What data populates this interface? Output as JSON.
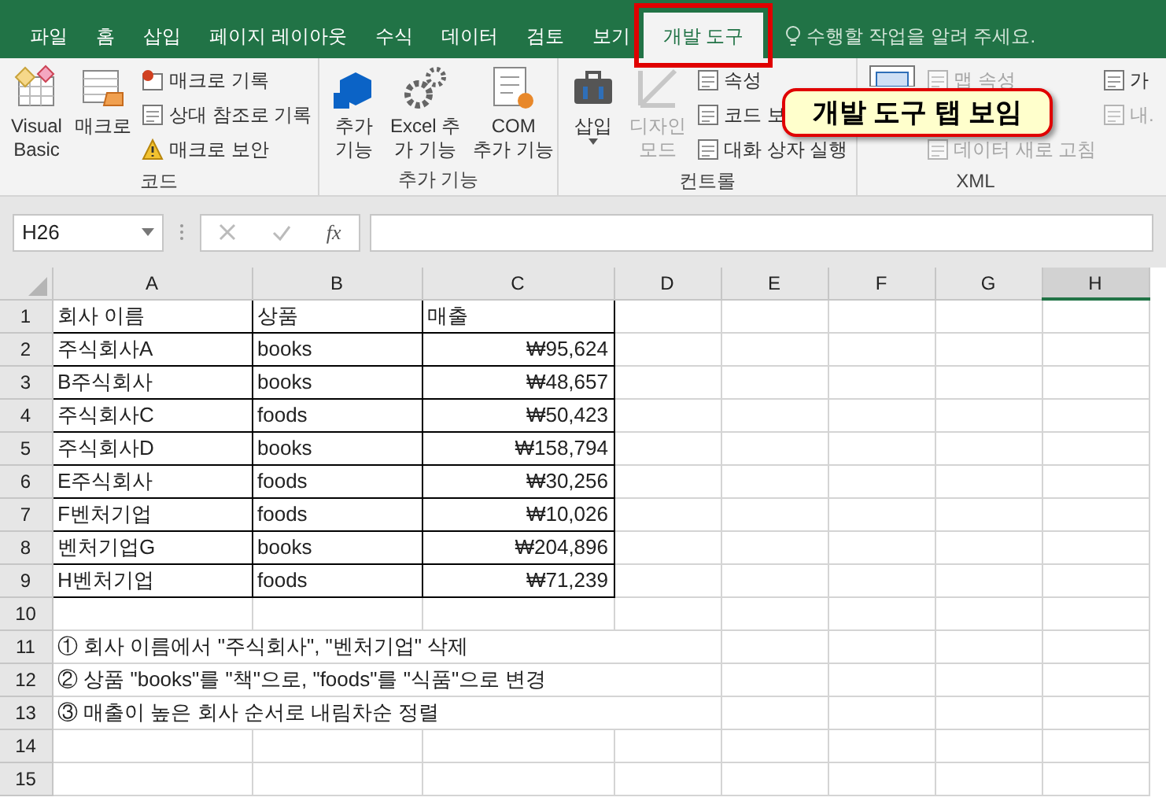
{
  "tabs": [
    {
      "label": "파일",
      "selected": false
    },
    {
      "label": "홈",
      "selected": false
    },
    {
      "label": "삽입",
      "selected": false
    },
    {
      "label": "페이지 레이아웃",
      "selected": false
    },
    {
      "label": "수식",
      "selected": false
    },
    {
      "label": "데이터",
      "selected": false
    },
    {
      "label": "검토",
      "selected": false
    },
    {
      "label": "보기",
      "selected": false
    },
    {
      "label": "개발 도구",
      "selected": true,
      "highlighted": true
    }
  ],
  "tell_me": {
    "placeholder": "수행할 작업을 알려 주세요."
  },
  "ribbon": {
    "groups": [
      {
        "label": "코드",
        "items": [
          {
            "kind": "large",
            "label": "Visual\nBasic",
            "disabled": false
          },
          {
            "kind": "large",
            "label": "매크로",
            "disabled": false
          },
          {
            "kind": "small",
            "label": "매크로 기록",
            "disabled": false
          },
          {
            "kind": "small",
            "label": "상대 참조로 기록",
            "disabled": false
          },
          {
            "kind": "small",
            "label": "매크로 보안",
            "disabled": false
          }
        ]
      },
      {
        "label": "추가 기능",
        "items": [
          {
            "kind": "large",
            "label": "추가\n기능",
            "disabled": false
          },
          {
            "kind": "large",
            "label": "Excel 추\n가 기능",
            "disabled": false
          },
          {
            "kind": "large",
            "label": "COM\n추가 기능",
            "disabled": false
          }
        ]
      },
      {
        "label": "컨트롤",
        "items": [
          {
            "kind": "large",
            "label": "삽입",
            "disabled": false
          },
          {
            "kind": "large",
            "label": "디자인\n모드",
            "disabled": true
          },
          {
            "kind": "small",
            "label": "속성",
            "disabled": false
          },
          {
            "kind": "small",
            "label": "코드 보",
            "disabled": false
          },
          {
            "kind": "small",
            "label": "대화 상자 실행",
            "disabled": false
          }
        ]
      },
      {
        "label": "XML",
        "items": [
          {
            "kind": "large",
            "disabled": false
          },
          {
            "kind": "small",
            "label": "맵 속성",
            "disabled": true
          },
          {
            "kind": "small",
            "label": "데이터 새로 고침",
            "disabled": true
          }
        ]
      },
      {
        "items": [
          {
            "kind": "small",
            "label": "가",
            "disabled": false
          },
          {
            "kind": "small",
            "label": "내.",
            "disabled": true
          }
        ]
      }
    ]
  },
  "callout": {
    "text": "개발 도구 탭 보임"
  },
  "formula_bar": {
    "name_box": "H26",
    "fx": "fx"
  },
  "sheet": {
    "columns": [
      {
        "label": "A",
        "selected": false
      },
      {
        "label": "B",
        "selected": false
      },
      {
        "label": "C",
        "selected": false
      },
      {
        "label": "D",
        "selected": false
      },
      {
        "label": "E",
        "selected": false
      },
      {
        "label": "F",
        "selected": false
      },
      {
        "label": "G",
        "selected": false
      },
      {
        "label": "H",
        "selected": true
      }
    ],
    "rows": [
      {
        "number": "1",
        "cells": [
          "회사 이름",
          "상품",
          "매출"
        ]
      },
      {
        "number": "2",
        "cells": [
          "주식회사A",
          "books",
          "₩95,624"
        ]
      },
      {
        "number": "3",
        "cells": [
          "B주식회사",
          "books",
          "₩48,657"
        ]
      },
      {
        "number": "4",
        "cells": [
          "주식회사C",
          "foods",
          "₩50,423"
        ]
      },
      {
        "number": "5",
        "cells": [
          "주식회사D",
          "books",
          "₩158,794"
        ]
      },
      {
        "number": "6",
        "cells": [
          "E주식회사",
          "foods",
          "₩30,256"
        ]
      },
      {
        "number": "7",
        "cells": [
          "F벤처기업",
          "foods",
          "₩10,026"
        ]
      },
      {
        "number": "8",
        "cells": [
          "벤처기업G",
          "books",
          "₩204,896"
        ]
      },
      {
        "number": "9",
        "cells": [
          "H벤처기업",
          "foods",
          "₩71,239"
        ]
      },
      {
        "number": "10"
      },
      {
        "number": "11",
        "note": "① 회사 이름에서 \"주식회사\", \"벤처기업\" 삭제"
      },
      {
        "number": "12",
        "note": "② 상품 \"books\"를 \"책\"으로, \"foods\"를 \"식품\"으로 변경"
      },
      {
        "number": "13",
        "note": "③ 매출이 높은 회사 순서로 내림차순 정렬"
      },
      {
        "number": "14"
      },
      {
        "number": "15"
      }
    ]
  }
}
